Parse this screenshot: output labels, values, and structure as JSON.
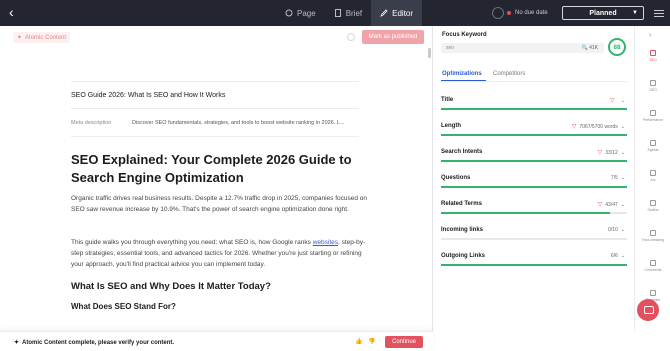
{
  "topbar": {
    "tabs": [
      {
        "label": "Page",
        "icon": "circle-icon",
        "active": false
      },
      {
        "label": "Brief",
        "icon": "doc-icon",
        "active": false
      },
      {
        "label": "Editor",
        "icon": "pen-icon",
        "active": true
      }
    ],
    "due_date": "No due date",
    "status": "Planned"
  },
  "editor": {
    "atomic_badge": "Atomic Content",
    "mark_published": "Mark as published",
    "meta_title": "SEO Guide 2026: What Is SEO and How It Works",
    "meta_desc_label": "Meta description",
    "meta_desc": "Discover SEO fundamentals, strategies, and tools to boost website ranking in 2026. L...",
    "h1": "SEO Explained: Your Complete 2026 Guide to Search Engine Optimization",
    "p1": "Organic traffic drives real business results. Despite a 12.7% traffic drop in 2025, companies focused on SEO saw revenue increase by 10.9%. That's the power of search engine optimization done right.",
    "p2_before": "This guide walks you through everything you need: what SEO is, how Google ranks ",
    "p2_link": "websites",
    "p2_after": ", step-by-step strategies, essential tools, and advanced tactics for 2026. Whether you're just starting or refining your approach, you'll find practical advice you can implement today.",
    "h2": "What Is SEO and Why Does It Matter Today?",
    "h3": "What Does SEO Stand For?",
    "banner": "Atomic Content complete, please verify your content.",
    "continue": "Continue"
  },
  "panel": {
    "focus_keyword_label": "Focus Keyword",
    "keyword": "seo",
    "volume": "41K",
    "score": "88",
    "tabs": [
      "Optimizations",
      "Competitors"
    ],
    "rows": [
      {
        "label": "Title",
        "value": "",
        "fill": 1.0,
        "warn": true
      },
      {
        "label": "Length",
        "value": "7067/5700 words",
        "fill": 1.0,
        "warn": true
      },
      {
        "label": "Search Intents",
        "value": "33/12",
        "fill": 1.0,
        "warn": true
      },
      {
        "label": "Questions",
        "value": "7/5",
        "fill": 1.0,
        "warn": false
      },
      {
        "label": "Related Terms",
        "value": "43/47",
        "fill": 0.91,
        "warn": true
      },
      {
        "label": "Incoming links",
        "value": "0/10",
        "fill": 0.0,
        "warn": false
      },
      {
        "label": "Outgoing Links",
        "value": "6/6",
        "fill": 1.0,
        "warn": false
      }
    ]
  },
  "rail": [
    {
      "label": "SEO",
      "active": true
    },
    {
      "label": "GEO"
    },
    {
      "label": "Performance"
    },
    {
      "label": "Agents"
    },
    {
      "label": "Arc"
    },
    {
      "label": "Outline"
    },
    {
      "label": "Fact-checking"
    },
    {
      "label": "Comments"
    },
    {
      "label": "Generate"
    }
  ]
}
